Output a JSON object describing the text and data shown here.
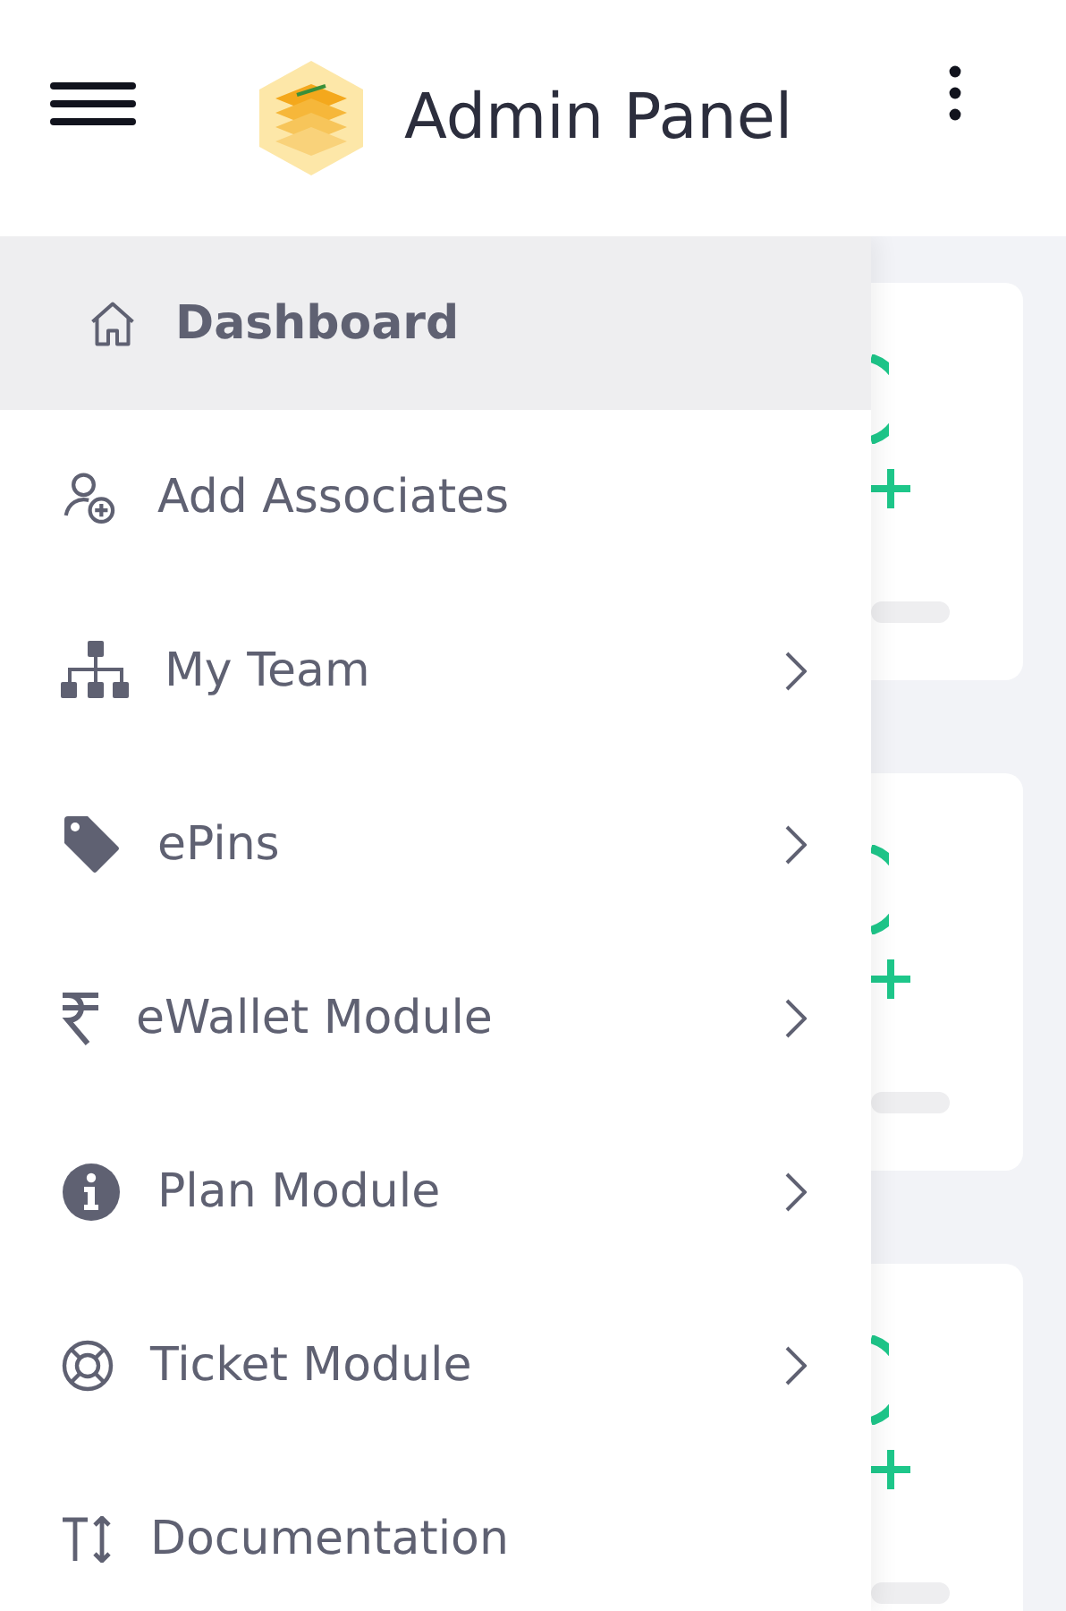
{
  "header": {
    "title": "Admin Panel"
  },
  "sidebar": {
    "items": [
      {
        "label": "Dashboard",
        "kind": "home",
        "selected": true,
        "expandable": false
      },
      {
        "label": "Add Associates",
        "kind": "user-add",
        "selected": false,
        "expandable": false
      },
      {
        "label": "My Team",
        "kind": "sitemap",
        "selected": false,
        "expandable": true
      },
      {
        "label": "ePins",
        "kind": "tag",
        "selected": false,
        "expandable": true
      },
      {
        "label": "eWallet Module",
        "kind": "rupee",
        "selected": false,
        "expandable": true
      },
      {
        "label": "Plan Module",
        "kind": "info",
        "selected": false,
        "expandable": true
      },
      {
        "label": "Ticket Module",
        "kind": "lifebuoy",
        "selected": false,
        "expandable": true
      },
      {
        "label": "Documentation",
        "kind": "text-size",
        "selected": false,
        "expandable": false
      }
    ]
  }
}
